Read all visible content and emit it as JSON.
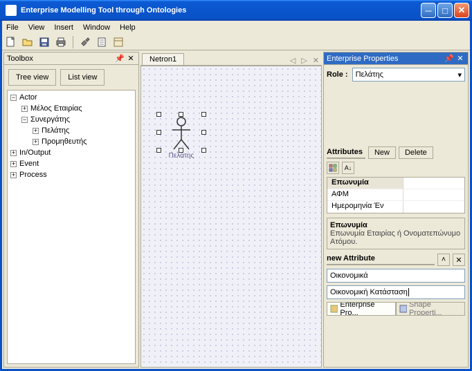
{
  "window": {
    "title": "Enterprise Modelling Tool through Ontologies"
  },
  "menu": {
    "file": "File",
    "view": "View",
    "insert": "Insert",
    "window": "Window",
    "help": "Help"
  },
  "toolbox": {
    "title": "Toolbox",
    "tree_view": "Tree view",
    "list_view": "List view",
    "tree": {
      "n0": "Actor",
      "n1": "Μέλος Εταιρίας",
      "n2": "Συνεργάτης",
      "n3": "Πελάτης",
      "n4": "Προμηθευτής",
      "n5": "In/Output",
      "n6": "Event",
      "n7": "Process"
    }
  },
  "canvas": {
    "tab": "Netron1",
    "actor_label": "Πελάτης"
  },
  "props": {
    "title": "Enterprise Properties",
    "role_label": "Role :",
    "role_value": "Πελάτης",
    "attributes_label": "Attributes",
    "new_btn": "New",
    "delete_btn": "Delete",
    "rows": {
      "r0": "Επωνυμία",
      "r1": "ΑΦΜ",
      "r2": "Ημερομηνία Έν"
    },
    "desc_title": "Επωνυμία",
    "desc_text": "Επωνυμία Εταιρίας ή Ονοματεπώνυμο Ατόμου.",
    "new_attr_label": "new Attribute",
    "input1": "Οικονομικά",
    "input2": "Οικονομική Κατάσταση",
    "bottom_tab_active": "Enterprise Pro...",
    "bottom_tab_inactive": "Shape Properti..."
  }
}
